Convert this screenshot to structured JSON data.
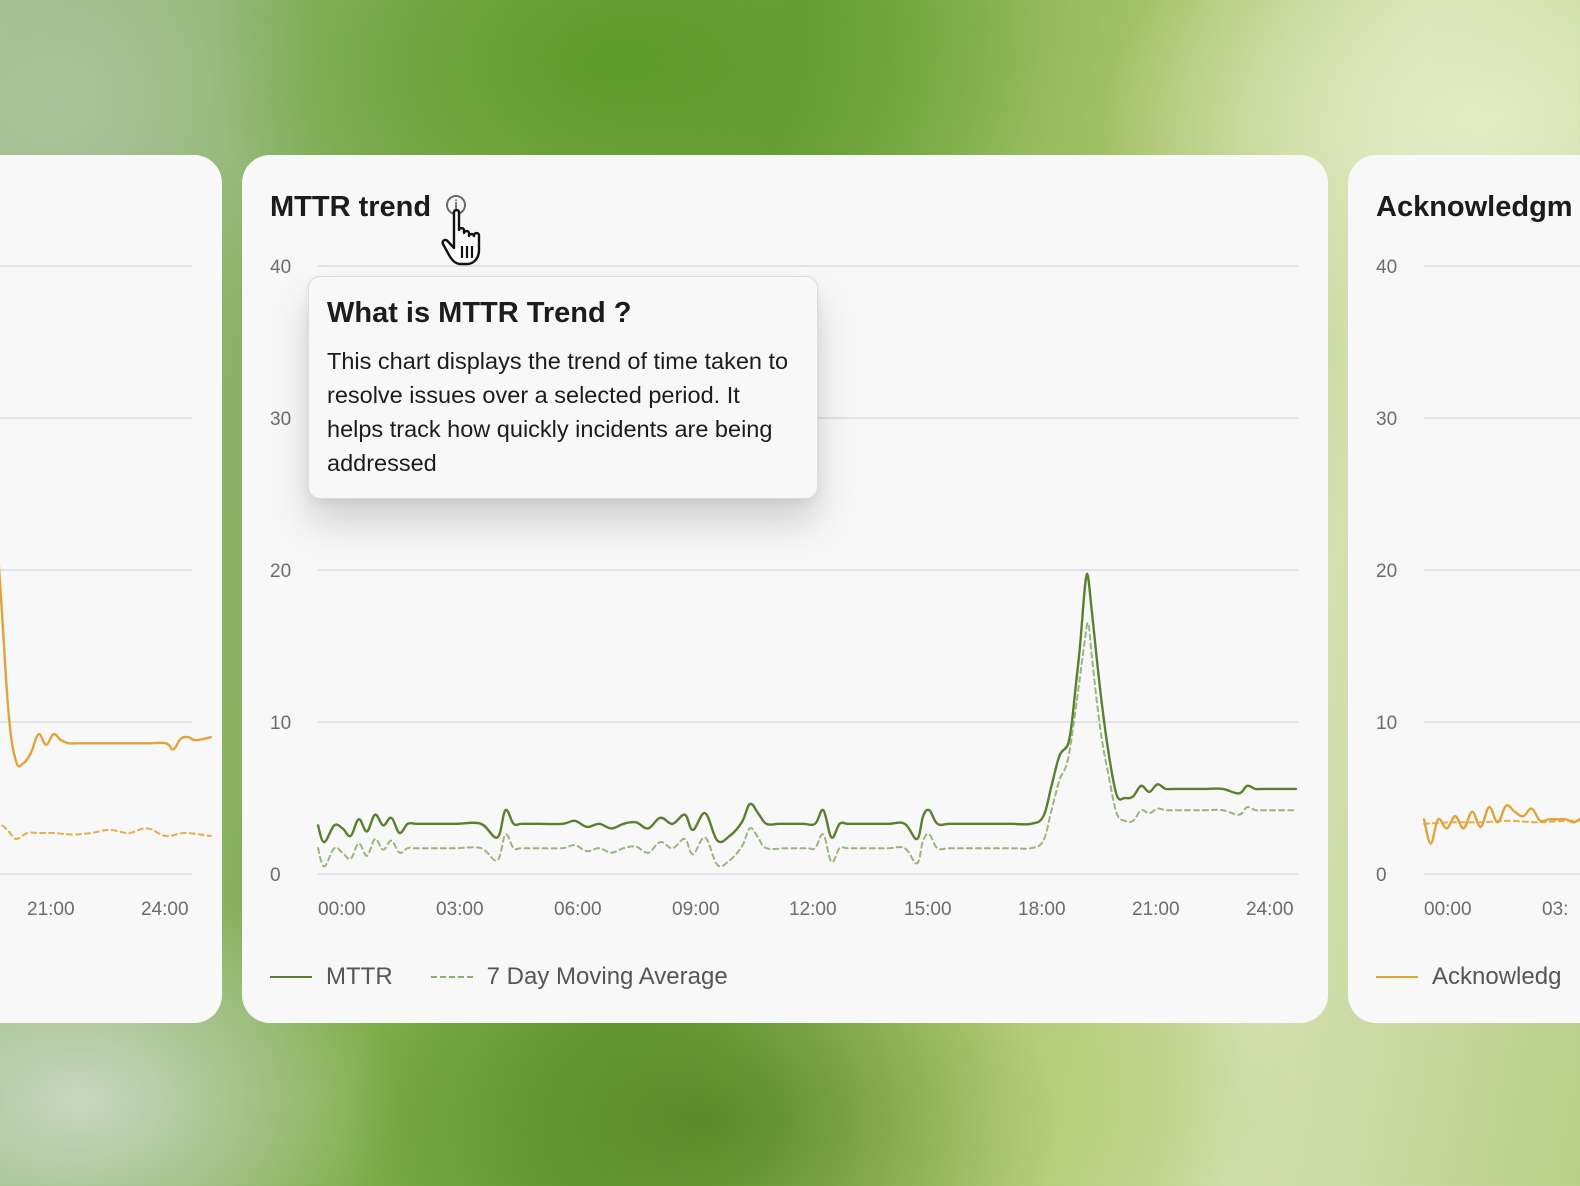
{
  "left_card": {
    "x_ticks": [
      "21:00",
      "24:00"
    ],
    "legend": []
  },
  "main_card": {
    "title": "MTTR trend",
    "tooltip": {
      "title": "What is MTTR Trend ?",
      "body": "This chart displays the trend of time taken to resolve issues over a selected period. It helps track how quickly incidents are being addressed"
    },
    "legend": [
      {
        "label": "MTTR",
        "style": "solid",
        "color": "#5b7f2e"
      },
      {
        "label": "7 Day Moving Average",
        "style": "dashed",
        "color": "#8fae6c"
      }
    ]
  },
  "right_card": {
    "title": "Acknowledgm",
    "x_ticks": [
      "00:00",
      "03:"
    ],
    "legend_label": "Acknowledg"
  },
  "colors": {
    "mttr": "#5b7f2e",
    "moving_average": "#8fae6c",
    "acknowledgement": "#e2a43a",
    "grid": "#e2e2e6"
  },
  "chart_data": [
    {
      "type": "line",
      "title": "",
      "xlabel": "",
      "ylabel": "",
      "ylim": [
        0,
        40
      ],
      "yticks": [
        0,
        10,
        20,
        30,
        40
      ],
      "x_tick_labels": [
        "21:00",
        "24:00"
      ],
      "xlim": [
        18.5,
        25.5
      ],
      "grid": true,
      "series": [
        {
          "name": "",
          "style": "solid",
          "color": "#e2a43a",
          "x": [
            18.5,
            18.9,
            19.1,
            19.2,
            19.25,
            19.3,
            19.6,
            19.8,
            20.0,
            20.2,
            20.4,
            20.6,
            20.8,
            21.0,
            21.2,
            21.4,
            21.6,
            21.8,
            22.0,
            22.5,
            23.0,
            23.5,
            24.0,
            24.2,
            24.4,
            24.6,
            24.8,
            25.2
          ],
          "values": [
            18.5,
            24.0,
            28.0,
            30.5,
            30.5,
            29.0,
            18.0,
            10.5,
            7.4,
            7.3,
            8.0,
            9.2,
            8.5,
            9.2,
            8.8,
            8.6,
            8.6,
            8.6,
            8.6,
            8.6,
            8.6,
            8.6,
            8.6,
            8.2,
            8.9,
            9.0,
            8.8,
            9.0
          ]
        },
        {
          "name": "",
          "style": "dashed",
          "color": "#e2a43a",
          "x": [
            18.5,
            19.0,
            19.4,
            19.6,
            19.8,
            20.0,
            20.3,
            20.6,
            21.0,
            21.5,
            22.0,
            22.5,
            23.0,
            23.5,
            24.0,
            24.5,
            25.2
          ],
          "values": [
            2.7,
            2.7,
            2.8,
            3.2,
            2.8,
            2.3,
            2.7,
            2.7,
            2.7,
            2.6,
            2.7,
            2.9,
            2.7,
            3.0,
            2.5,
            2.7,
            2.5
          ]
        }
      ]
    },
    {
      "type": "line",
      "title": "MTTR trend",
      "xlabel": "",
      "ylabel": "",
      "ylim": [
        0,
        40
      ],
      "yticks": [
        0,
        10,
        20,
        30,
        40
      ],
      "x_tick_labels": [
        "00:00",
        "03:00",
        "06:00",
        "09:00",
        "12:00",
        "15:00",
        "18:00",
        "21:00",
        "24:00"
      ],
      "xlim": [
        0,
        24
      ],
      "grid": true,
      "legend": "bottom-left",
      "series": [
        {
          "name": "MTTR",
          "style": "solid",
          "color": "#5b7f2e",
          "x": [
            0,
            0.15,
            0.4,
            0.6,
            0.8,
            1.0,
            1.2,
            1.4,
            1.6,
            1.8,
            2.0,
            2.2,
            2.4,
            2.6,
            2.8,
            3.0,
            3.4,
            4.0,
            4.4,
            4.6,
            4.8,
            5.0,
            5.4,
            6.0,
            6.3,
            6.6,
            6.9,
            7.2,
            7.5,
            7.8,
            8.1,
            8.4,
            8.7,
            9.0,
            9.2,
            9.5,
            9.8,
            10.1,
            10.4,
            10.6,
            10.8,
            11.0,
            11.3,
            11.6,
            11.9,
            12.2,
            12.4,
            12.6,
            12.8,
            13.0,
            13.3,
            13.6,
            14.0,
            14.4,
            14.7,
            14.85,
            15.0,
            15.2,
            15.5,
            16.0,
            16.5,
            17.0,
            17.5,
            17.8,
            18.0,
            18.2,
            18.4,
            18.5,
            18.6,
            18.7,
            18.8,
            18.85,
            18.9,
            19.0,
            19.2,
            19.4,
            19.6,
            19.8,
            20.0,
            20.2,
            20.4,
            20.6,
            20.8,
            21.0,
            21.4,
            21.8,
            22.2,
            22.6,
            22.8,
            23.0,
            23.2,
            23.5,
            24.0
          ],
          "values": [
            3.2,
            2.1,
            3.2,
            3.0,
            2.5,
            3.6,
            2.8,
            3.9,
            3.2,
            3.7,
            2.7,
            3.3,
            3.3,
            3.3,
            3.3,
            3.3,
            3.3,
            3.3,
            2.4,
            4.2,
            3.3,
            3.3,
            3.3,
            3.3,
            3.5,
            3.1,
            3.3,
            3.0,
            3.3,
            3.4,
            3.0,
            3.7,
            3.3,
            3.9,
            2.9,
            4.0,
            2.2,
            2.5,
            3.4,
            4.6,
            4.0,
            3.3,
            3.3,
            3.3,
            3.3,
            3.3,
            4.2,
            2.4,
            3.3,
            3.3,
            3.3,
            3.3,
            3.3,
            3.3,
            2.3,
            3.8,
            4.2,
            3.3,
            3.3,
            3.3,
            3.3,
            3.3,
            3.3,
            3.8,
            5.8,
            7.8,
            8.5,
            10.0,
            12.5,
            15.0,
            18.3,
            19.5,
            19.5,
            17.0,
            12.0,
            8.0,
            5.2,
            5.0,
            5.1,
            5.8,
            5.4,
            5.9,
            5.6,
            5.6,
            5.6,
            5.6,
            5.6,
            5.3,
            5.8,
            5.6,
            5.6,
            5.6,
            5.6
          ]
        },
        {
          "name": "7 Day Moving Average",
          "style": "dashed",
          "color": "#8fae6c",
          "x": [
            0,
            0.15,
            0.4,
            0.6,
            0.8,
            1.0,
            1.2,
            1.4,
            1.6,
            1.8,
            2.0,
            2.2,
            2.4,
            3.0,
            3.4,
            4.0,
            4.4,
            4.6,
            4.8,
            5.0,
            5.4,
            6.0,
            6.3,
            6.6,
            6.9,
            7.2,
            7.5,
            7.8,
            8.1,
            8.4,
            8.7,
            9.0,
            9.2,
            9.5,
            9.8,
            10.1,
            10.4,
            10.6,
            10.8,
            11.0,
            11.5,
            12.0,
            12.2,
            12.4,
            12.6,
            12.8,
            13.0,
            13.5,
            14.0,
            14.4,
            14.7,
            14.85,
            15.0,
            15.2,
            15.5,
            16.0,
            16.5,
            17.0,
            17.5,
            17.8,
            18.0,
            18.2,
            18.4,
            18.6,
            18.8,
            18.9,
            19.0,
            19.2,
            19.4,
            19.6,
            19.8,
            20.0,
            20.2,
            20.4,
            20.6,
            20.8,
            21.0,
            21.4,
            21.8,
            22.2,
            22.6,
            22.8,
            23.0,
            23.2,
            23.5,
            24.0
          ],
          "values": [
            1.7,
            0.5,
            1.7,
            1.4,
            1.0,
            2.0,
            1.2,
            2.3,
            1.6,
            2.2,
            1.4,
            1.7,
            1.7,
            1.7,
            1.7,
            1.7,
            0.9,
            2.6,
            1.7,
            1.7,
            1.7,
            1.7,
            1.9,
            1.5,
            1.7,
            1.4,
            1.7,
            1.8,
            1.4,
            2.1,
            1.7,
            2.3,
            1.3,
            2.4,
            0.6,
            0.9,
            1.8,
            3.0,
            2.4,
            1.7,
            1.7,
            1.7,
            1.7,
            2.6,
            0.8,
            1.7,
            1.7,
            1.7,
            1.7,
            1.7,
            0.7,
            2.2,
            2.6,
            1.7,
            1.7,
            1.7,
            1.7,
            1.7,
            1.7,
            2.2,
            4.2,
            6.2,
            7.5,
            11.0,
            15.0,
            16.5,
            14.0,
            9.5,
            6.5,
            4.0,
            3.5,
            3.5,
            4.2,
            4.0,
            4.3,
            4.2,
            4.2,
            4.2,
            4.2,
            4.2,
            3.9,
            4.4,
            4.2,
            4.2,
            4.2,
            4.2
          ]
        }
      ]
    },
    {
      "type": "line",
      "title": "Acknowledgm",
      "xlabel": "",
      "ylabel": "",
      "ylim": [
        0,
        40
      ],
      "yticks": [
        0,
        10,
        20,
        30,
        40
      ],
      "x_tick_labels": [
        "00:00",
        "03:"
      ],
      "xlim": [
        0,
        3.6
      ],
      "grid": true,
      "series": [
        {
          "name": "Acknowledg",
          "style": "solid",
          "color": "#e2a43a",
          "x": [
            0,
            0.12,
            0.25,
            0.4,
            0.55,
            0.7,
            0.85,
            1.0,
            1.15,
            1.3,
            1.45,
            1.6,
            1.75,
            1.9,
            2.05,
            2.2,
            2.35,
            2.5,
            2.65,
            2.8,
            2.95,
            3.1,
            3.3,
            3.6
          ],
          "values": [
            3.6,
            2.0,
            3.6,
            3.0,
            3.8,
            3.0,
            4.1,
            3.1,
            4.4,
            3.4,
            4.5,
            4.1,
            3.8,
            4.3,
            3.5,
            3.6,
            3.6,
            3.6,
            3.4,
            3.7,
            3.5,
            3.7,
            3.7,
            3.7
          ]
        },
        {
          "name": "",
          "style": "dashed",
          "color": "#e2a43a",
          "x": [
            0,
            0.5,
            1.0,
            1.5,
            2.0,
            2.5,
            3.0,
            3.6
          ],
          "values": [
            3.3,
            3.4,
            3.4,
            3.5,
            3.4,
            3.5,
            3.5,
            3.5
          ]
        }
      ]
    }
  ]
}
